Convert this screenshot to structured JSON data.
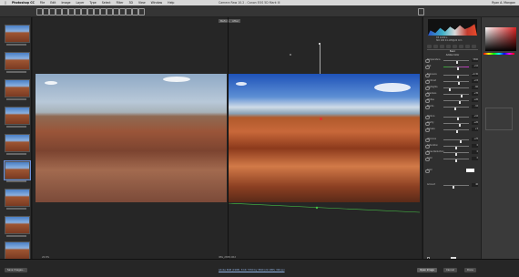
{
  "menubar": {
    "app": "Photoshop CC",
    "items": [
      "File",
      "Edit",
      "Image",
      "Layer",
      "Type",
      "Select",
      "Filter",
      "3D",
      "View",
      "Window",
      "Help"
    ],
    "window_title": "Camera Raw 10.2 - Canon EOS 5D Mark III",
    "user": "Ryan A. Mangan"
  },
  "canvas": {
    "before_label": "Before",
    "after_label": "After",
    "zoom_text": "20.8%",
    "filename": "IMG_2838.CR2"
  },
  "rpanel": {
    "histogram_meta": [
      "f/8   1/200 s",
      "ISO 100   24-105@24 mm"
    ],
    "section_title": "Basic",
    "profile_label": "Adobe Color",
    "sliders": [
      {
        "label": "Temperature",
        "value": "5500"
      },
      {
        "label": "Tint",
        "value": "+10"
      },
      {
        "label": "Exposure",
        "value": "+0.30"
      },
      {
        "label": "Contrast",
        "value": "+15"
      },
      {
        "label": "Highlights",
        "value": "-60"
      },
      {
        "label": "Shadows",
        "value": "+35"
      },
      {
        "label": "Whites",
        "value": "+20"
      },
      {
        "label": "Blacks",
        "value": "-10"
      },
      {
        "label": "Texture",
        "value": "+10"
      },
      {
        "label": "Clarity",
        "value": "+20"
      },
      {
        "label": "Dehaze",
        "value": "+5"
      },
      {
        "label": "Vibrance",
        "value": "+25"
      },
      {
        "label": "Saturation",
        "value": "0"
      },
      {
        "label": "Noise Reduction",
        "value": "0"
      },
      {
        "label": "Color",
        "value": "0"
      },
      {
        "label": "Amount",
        "value": "40"
      }
    ],
    "color_label": "Color"
  },
  "bottombar": {
    "save_label": "Save Images...",
    "info_link": "Adobe RGB (1998); 8 bit; 5760 by 3840 (22.1MP); 300 ppi",
    "open_label": "Open Image",
    "cancel_label": "Cancel",
    "done_label": "Done"
  },
  "colors": {
    "accent": "#6c8fd8",
    "panel_bg": "#2f2f2f"
  }
}
